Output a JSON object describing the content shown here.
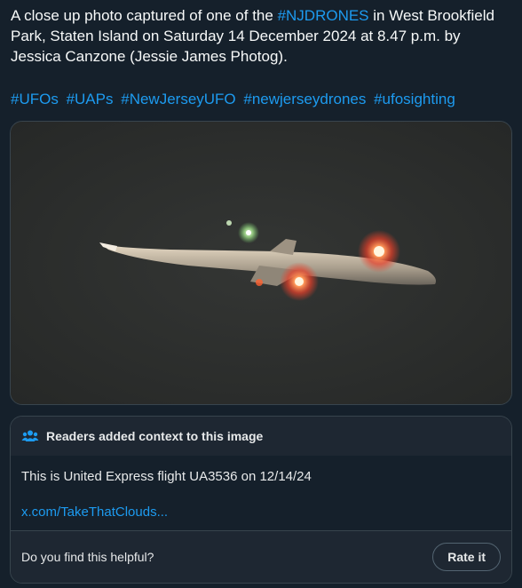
{
  "tweet": {
    "line1_before": "A close up photo captured of one of the ",
    "line1_link": "#NJDRONES",
    "line1_after": " in West Brookfield",
    "line2": "Park, Staten Island on Saturday 14 December 2024 at 8.47 p.m. by",
    "line3": "Jessica Canzone (Jessie James Photog).",
    "hashtags": [
      "#UFOs",
      "#UAPs",
      "#NewJerseyUFO",
      "#newjerseydrones",
      "#ufosighting"
    ]
  },
  "media": {
    "icon": "aircraft-night-photo"
  },
  "context_note": {
    "header_icon": "people-icon",
    "title": "Readers added context to this image",
    "body": "This is United Express flight UA3536 on 12/14/24",
    "source_link": "x.com/TakeThatClouds...",
    "question": "Do you find this helpful?",
    "rate_label": "Rate it"
  },
  "colors": {
    "background": "#15202b",
    "link": "#1d9bf0",
    "text": "#f7f9f9",
    "border": "#38444d"
  }
}
